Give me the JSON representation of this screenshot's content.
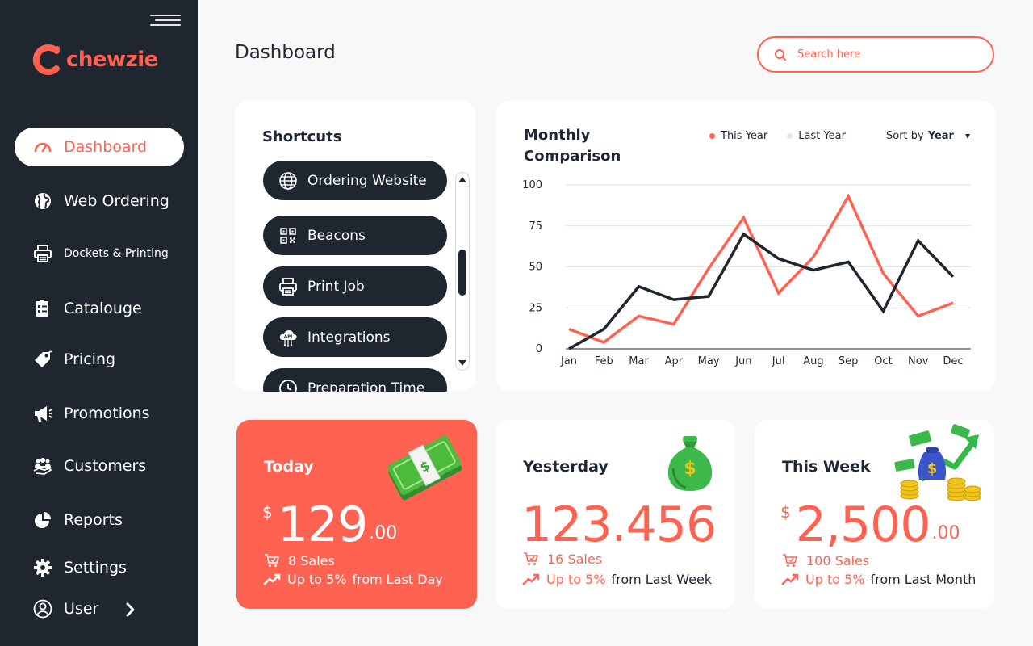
{
  "brand": {
    "name": "chewzie",
    "accent": "#ff6251",
    "dark": "#1f2630"
  },
  "sidebar": {
    "items": [
      {
        "label": "Dashboard",
        "icon": "speedometer-icon",
        "active": true
      },
      {
        "label": "Web Ordering",
        "icon": "globe-icon"
      },
      {
        "label": "Dockets & Printing",
        "icon": "printer-icon"
      },
      {
        "label": "Catalouge",
        "icon": "catalogue-icon"
      },
      {
        "label": "Pricing",
        "icon": "price-tag-icon"
      },
      {
        "label": "Promotions",
        "icon": "megaphone-icon"
      },
      {
        "label": "Customers",
        "icon": "customers-icon"
      },
      {
        "label": "Reports",
        "icon": "pie-chart-icon"
      },
      {
        "label": "Settings",
        "icon": "gear-icon"
      },
      {
        "label": "User",
        "icon": "user-icon"
      }
    ]
  },
  "header": {
    "title": "Dashboard",
    "search_placeholder": "Search here"
  },
  "shortcuts": {
    "title": "Shortcuts",
    "items": [
      {
        "label": "Ordering Website",
        "icon": "globe-icon"
      },
      {
        "label": "Beacons",
        "icon": "qr-code-icon"
      },
      {
        "label": "Print Job",
        "icon": "printer-icon"
      },
      {
        "label": "Integrations",
        "icon": "api-cloud-icon"
      },
      {
        "label": "Preparation Time",
        "icon": "clock-icon"
      }
    ]
  },
  "comparison": {
    "title": "Monthly Comparison",
    "legend_this_year": "This Year",
    "legend_last_year": "Last Year",
    "sort_label": "Sort by",
    "sort_value": "Year"
  },
  "chart_data": {
    "type": "line",
    "title": "Monthly Comparison",
    "x": [
      "Jan",
      "Feb",
      "Mar",
      "Apr",
      "May",
      "Jun",
      "Jul",
      "Aug",
      "Sep",
      "Oct",
      "Nov",
      "Dec"
    ],
    "yticks": [
      0,
      25,
      50,
      75,
      100
    ],
    "ylim": [
      0,
      100
    ],
    "grid": true,
    "legend_position": "top-right",
    "series": [
      {
        "name": "This Year",
        "color": "#ff6251",
        "values": [
          12,
          4,
          20,
          15,
          49,
          80,
          34,
          56,
          93,
          46,
          20,
          28
        ]
      },
      {
        "name": "Last Year",
        "color": "#1f2630",
        "values": [
          0,
          12,
          38,
          30,
          32,
          70,
          55,
          48,
          53,
          23,
          66,
          44
        ]
      }
    ]
  },
  "stats": {
    "today": {
      "title": "Today",
      "currency": "$",
      "amount": "129",
      "cents": ".00",
      "sales": "8 Sales",
      "trend": "Up to 5%",
      "trend_suffix": "from Last Day"
    },
    "yesterday": {
      "title": "Yesterday",
      "amount": "123.456",
      "sales": "16 Sales",
      "trend": "Up to 5%",
      "trend_suffix": "from Last Week"
    },
    "week": {
      "title": "This Week",
      "currency": "$",
      "amount": "2,500",
      "cents": ".00",
      "sales": "100 Sales",
      "trend": "Up to 5%",
      "trend_suffix": "from Last Month"
    }
  }
}
